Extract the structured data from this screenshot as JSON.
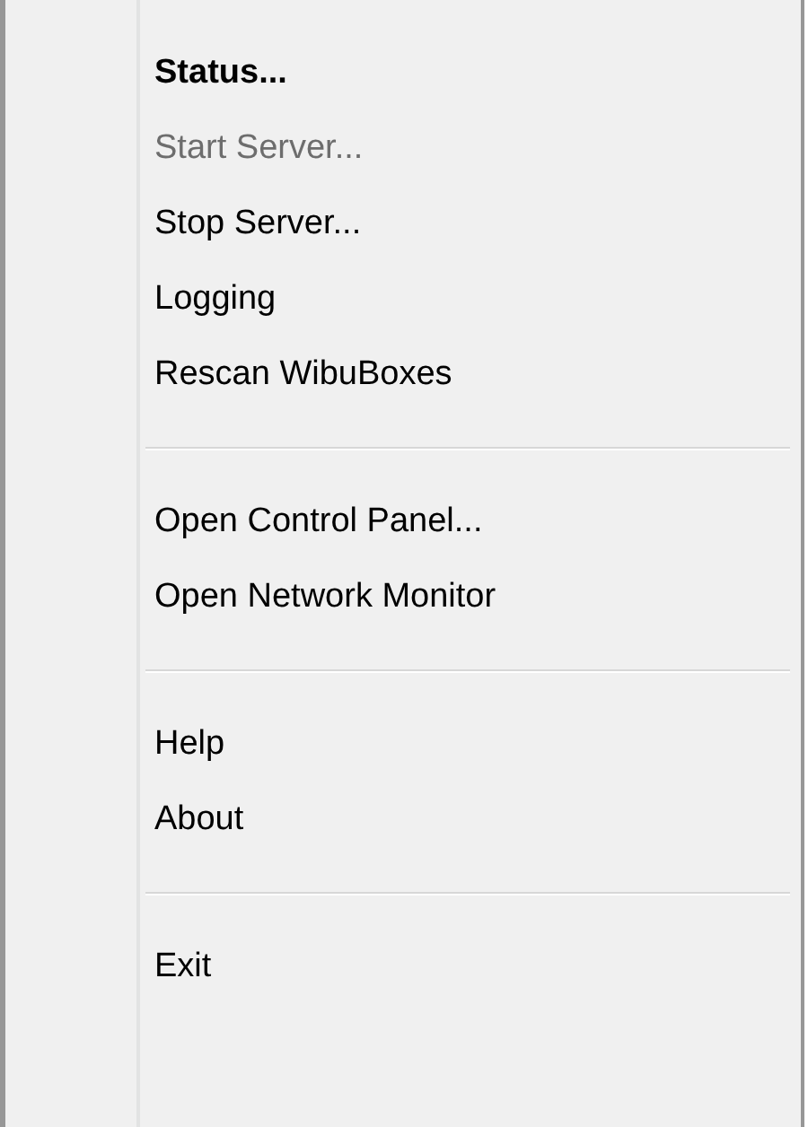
{
  "menu": {
    "items": [
      {
        "kind": "item",
        "label": "Status...",
        "default": true,
        "disabled": false
      },
      {
        "kind": "item",
        "label": "Start Server...",
        "default": false,
        "disabled": true
      },
      {
        "kind": "item",
        "label": "Stop Server...",
        "default": false,
        "disabled": false
      },
      {
        "kind": "item",
        "label": "Logging",
        "default": false,
        "disabled": false
      },
      {
        "kind": "item",
        "label": "Rescan WibuBoxes",
        "default": false,
        "disabled": false
      },
      {
        "kind": "separator"
      },
      {
        "kind": "item",
        "label": "Open Control Panel...",
        "default": false,
        "disabled": false
      },
      {
        "kind": "item",
        "label": "Open Network Monitor",
        "default": false,
        "disabled": false
      },
      {
        "kind": "separator"
      },
      {
        "kind": "item",
        "label": "Help",
        "default": false,
        "disabled": false
      },
      {
        "kind": "item",
        "label": "About",
        "default": false,
        "disabled": false
      },
      {
        "kind": "separator"
      },
      {
        "kind": "item",
        "label": "Exit",
        "default": false,
        "disabled": false
      }
    ]
  }
}
